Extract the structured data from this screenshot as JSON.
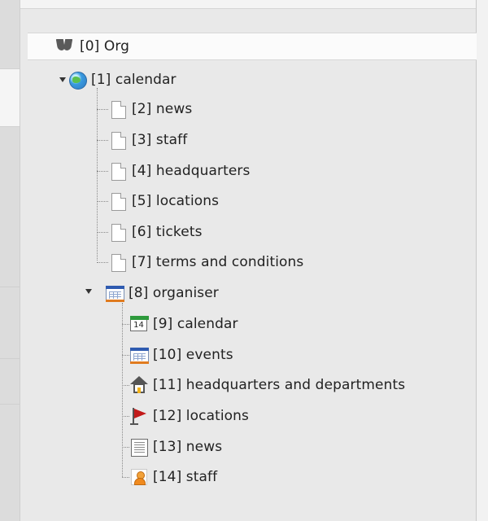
{
  "tree": {
    "root": {
      "label": "[0] Org",
      "icon": "typo3-logo-icon"
    },
    "site": {
      "label": "[1] calendar",
      "icon": "globe-icon",
      "expanded": true
    },
    "site_children": [
      {
        "label": "[2] news",
        "icon": "page-icon"
      },
      {
        "label": "[3] staff",
        "icon": "page-icon"
      },
      {
        "label": "[4] headquarters",
        "icon": "page-icon"
      },
      {
        "label": "[5] locations",
        "icon": "page-icon"
      },
      {
        "label": "[6] tickets",
        "icon": "page-icon"
      },
      {
        "label": "[7] terms and conditions",
        "icon": "page-icon"
      }
    ],
    "folder": {
      "label": "[8] organiser",
      "icon": "calendar-grid-icon",
      "expanded": true
    },
    "folder_children": [
      {
        "label": "[9] calendar",
        "icon": "calendar-14-icon"
      },
      {
        "label": "[10] events",
        "icon": "calendar-grid-icon"
      },
      {
        "label": "[11] headquarters and departments",
        "icon": "house-icon"
      },
      {
        "label": "[12] locations",
        "icon": "flag-icon"
      },
      {
        "label": "[13] news",
        "icon": "list-icon"
      },
      {
        "label": "[14] staff",
        "icon": "person-icon"
      }
    ],
    "calendar_day": "14"
  },
  "colors": {
    "background": "#e9e9e9",
    "root_row": "#fbfbfb",
    "flag": "#c21a1a",
    "calendar_header": "#2f5bb0",
    "calendar_green": "#2e9a3c",
    "accent_orange": "#e07b1f"
  }
}
